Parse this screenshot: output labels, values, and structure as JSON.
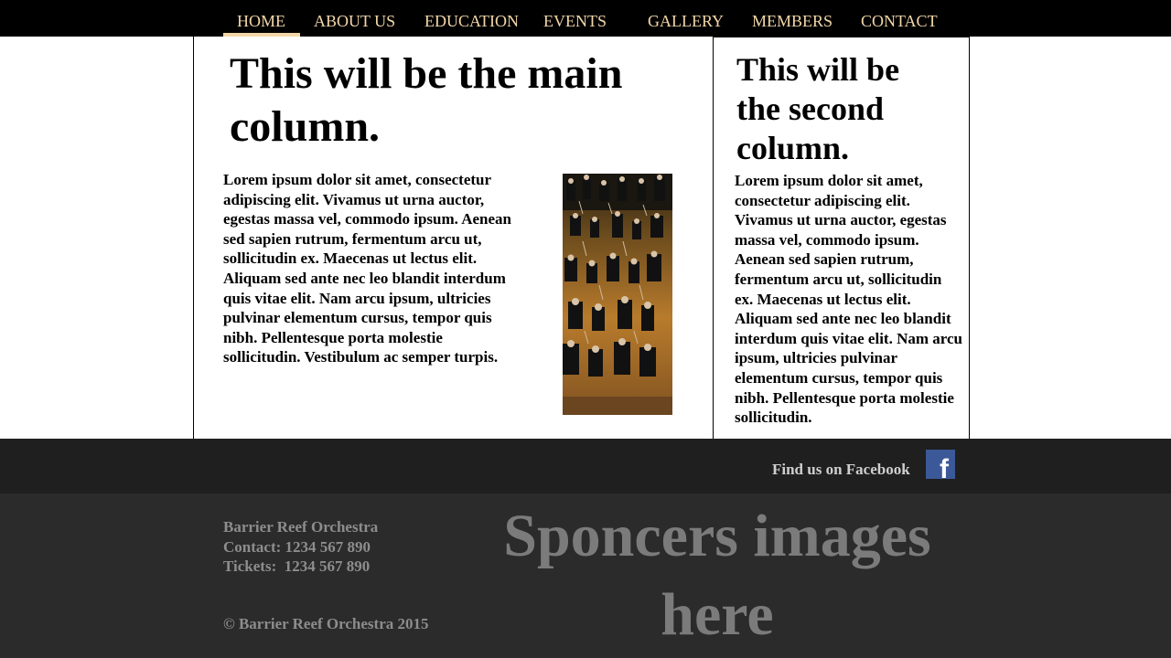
{
  "nav": {
    "items": [
      "HOME",
      "ABOUT US",
      "EDUCATION",
      "EVENTS",
      "GALLERY",
      "MEMBERS",
      "CONTACT"
    ],
    "active": "HOME"
  },
  "main": {
    "heading": "This will be the main column.",
    "paragraph": "Lorem ipsum dolor sit amet, consectetur adipiscing elit. Vivamus ut urna auctor, egestas massa vel, commodo ipsum. Aenean sed sapien rutrum, fermentum arcu ut, sollicitudin ex. Maecenas ut lectus elit. Aliquam sed ante nec leo blandit interdum quis vitae elit. Nam arcu ipsum, ultricies pulvinar elementum cursus, tempor quis nibh. Pellentesque porta molestie sollicitudin. Vestibulum ac semper turpis."
  },
  "side": {
    "heading": "This will be the second column.",
    "paragraph": "Lorem ipsum dolor sit amet, consectetur adipiscing elit. Vivamus ut urna auctor, egestas massa vel, commodo ipsum. Aenean sed sapien rutrum, fermentum arcu ut, sollicitudin ex. Maecenas ut lectus elit. Aliquam sed ante nec leo blandit interdum quis vitae elit. Nam arcu ipsum, ultricies pulvinar elementum cursus, tempor quis nibh. Pellentesque porta molestie sollicitudin."
  },
  "social": {
    "facebook_text": "Find us on Facebook",
    "facebook_icon": "facebook-icon",
    "facebook_letter": "f"
  },
  "footer": {
    "org": "Barrier Reef Orchestra",
    "contact": "Contact: 1234 567 890",
    "tickets": "Tickets:  1234 567 890",
    "copyright": "© Barrier Reef Orchestra 2015",
    "sponsors": "Sponcers images here"
  },
  "colors": {
    "nav_bg": "#000000",
    "nav_text": "#f3d7a8",
    "fb_band": "#1f1f1f",
    "footer_bg": "#2b2b2b",
    "facebook_blue": "#3b5998"
  }
}
